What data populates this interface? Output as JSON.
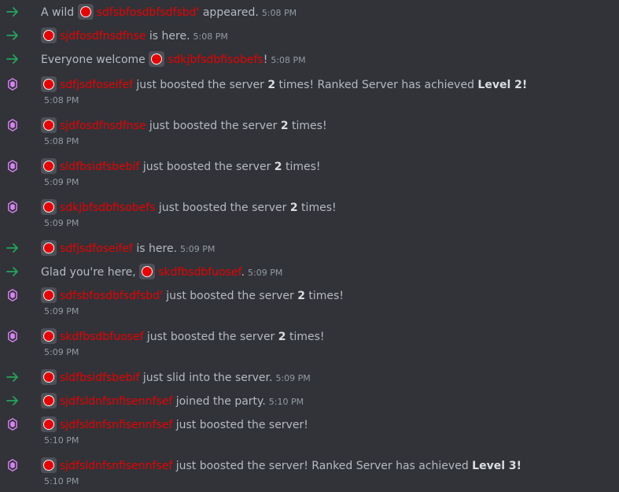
{
  "colors": {
    "background": "#313338",
    "username": "#e80000",
    "join_arrow": "#23a55a",
    "boost_gem": "#d883f4",
    "text": "#b5bac1",
    "timestamp": "#949ba4"
  },
  "icons": {
    "join": "arrow-right-icon",
    "boost": "nitro-gem-icon"
  },
  "messages": [
    {
      "kind": "join",
      "pre": "A wild ",
      "user": "sdfsbfosdbfsdfsbd'",
      "post": " appeared.",
      "time": "5:08 PM"
    },
    {
      "kind": "join",
      "pre": "",
      "user": "sjdfosdfnsdfnse",
      "post": " is here.",
      "time": "5:08 PM"
    },
    {
      "kind": "join",
      "pre": "Everyone welcome ",
      "user": "sdkjbfsdbfisobefs",
      "post": "!",
      "time": "5:08 PM"
    },
    {
      "kind": "boost",
      "user": "sdfjsdfoseifef",
      "post": " just boosted the server ",
      "count": "2",
      "post2": " times! Ranked Server has achieved ",
      "level": "Level 2!",
      "time": "5:08 PM"
    },
    {
      "kind": "boost",
      "user": "sjdfosdfnsdfnse",
      "post": " just boosted the server ",
      "count": "2",
      "post2": " times!",
      "level": "",
      "time": "5:08 PM"
    },
    {
      "kind": "boost",
      "user": "sldfbsidfsbebif",
      "post": " just boosted the server ",
      "count": "2",
      "post2": " times!",
      "level": "",
      "time": "5:09 PM"
    },
    {
      "kind": "boost",
      "user": "sdkjbfsdbfisobefs",
      "post": " just boosted the server ",
      "count": "2",
      "post2": " times!",
      "level": "",
      "time": "5:09 PM"
    },
    {
      "kind": "join",
      "pre": "",
      "user": "sdfjsdfoseifef",
      "post": " is here.",
      "time": "5:09 PM"
    },
    {
      "kind": "join",
      "pre": "Glad you're here, ",
      "user": "skdfbsdbfuosef",
      "post": ".",
      "time": "5:09 PM"
    },
    {
      "kind": "boost",
      "user": "sdfsbfosdbfsdfsbd'",
      "post": " just boosted the server ",
      "count": "2",
      "post2": " times!",
      "level": "",
      "time": "5:09 PM"
    },
    {
      "kind": "boost",
      "user": "skdfbsdbfuosef",
      "post": " just boosted the server ",
      "count": "2",
      "post2": " times!",
      "level": "",
      "time": "5:09 PM"
    },
    {
      "kind": "join",
      "pre": "",
      "user": "sldfbsidfsbebif",
      "post": " just slid into the server.",
      "time": "5:09 PM"
    },
    {
      "kind": "join",
      "pre": "",
      "user": "sjdfsldnfsnfisennfsef",
      "post": " joined the party.",
      "time": "5:10 PM"
    },
    {
      "kind": "boost",
      "user": "sjdfsldnfsnfisennfsef",
      "post": " just boosted the server!",
      "count": "",
      "post2": "",
      "level": "",
      "time": "5:10 PM"
    },
    {
      "kind": "boost",
      "user": "sjdfsldnfsnfisennfsef",
      "post": " just boosted the server! Ranked Server has achieved ",
      "count": "",
      "post2": "",
      "level": "Level 3!",
      "time": "5:10 PM"
    }
  ]
}
